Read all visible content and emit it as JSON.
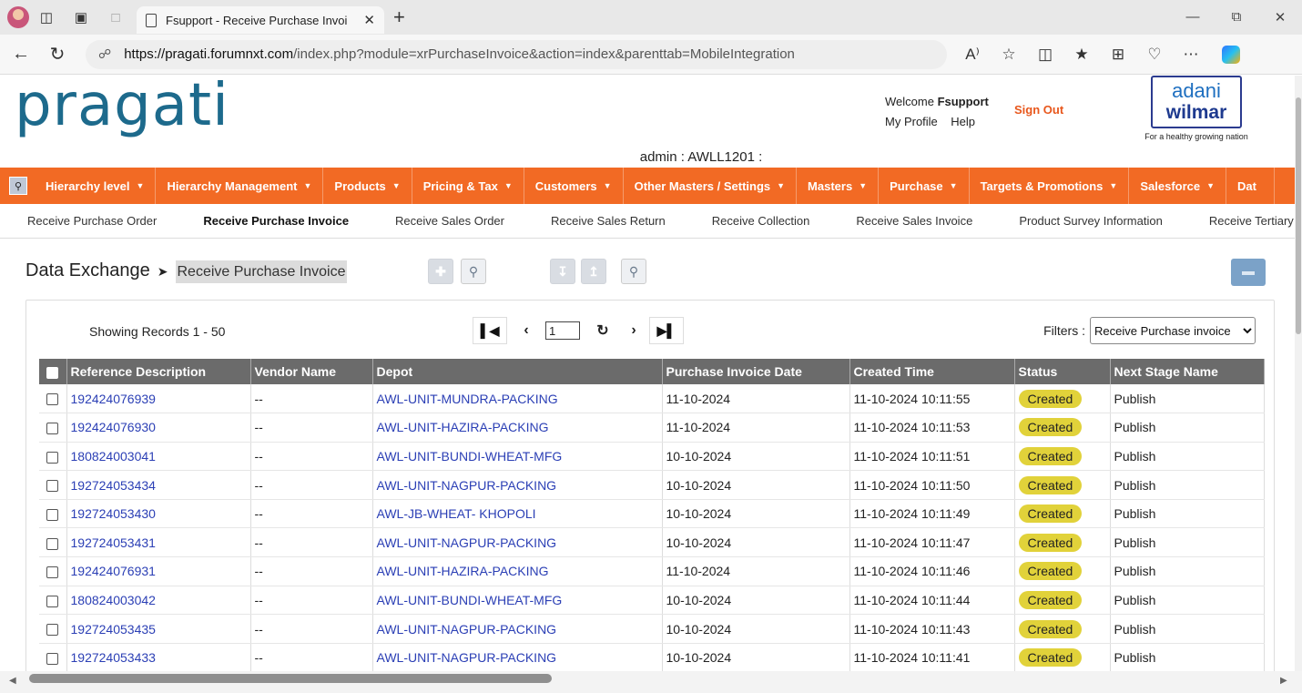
{
  "browser": {
    "tab_title": "Fsupport - Receive Purchase Invoi",
    "url_domain": "https://pragati.forumnxt.com",
    "url_path": "/index.php?module=xrPurchaseInvoice&action=index&parenttab=MobileIntegration"
  },
  "header": {
    "logo": "pragati",
    "welcome_prefix": "Welcome ",
    "welcome_user": "Fsupport",
    "my_profile": "My Profile",
    "help": "Help",
    "sign_out": "Sign Out",
    "brand_line1": "adani",
    "brand_line2": "wilmar",
    "brand_tagline": "For a healthy growing nation",
    "admin_line": "admin : AWLL1201 :"
  },
  "menu": [
    "Hierarchy level",
    "Hierarchy Management",
    "Products",
    "Pricing & Tax",
    "Customers",
    "Other Masters / Settings",
    "Masters",
    "Purchase",
    "Targets & Promotions",
    "Salesforce",
    "Dat"
  ],
  "submenu": [
    "Receive Purchase Order",
    "Receive Purchase Invoice",
    "Receive Sales Order",
    "Receive Sales Return",
    "Receive Collection",
    "Receive Sales Invoice",
    "Product Survey Information",
    "Receive Tertiary Stock"
  ],
  "page": {
    "title": "Data Exchange",
    "current": "Receive Purchase Invoice",
    "records_info": "Showing Records 1 - 50",
    "page_number": "1",
    "filters_label": "Filters :",
    "filter_value": "Receive Purchase invoice"
  },
  "table": {
    "columns": [
      "Reference Description",
      "Vendor Name",
      "Depot",
      "Purchase Invoice Date",
      "Created Time",
      "Status",
      "Next Stage Name"
    ],
    "rows": [
      [
        "192424076939",
        "--",
        "AWL-UNIT-MUNDRA-PACKING",
        "11-10-2024",
        "11-10-2024 10:11:55",
        "Created",
        "Publish"
      ],
      [
        "192424076930",
        "--",
        "AWL-UNIT-HAZIRA-PACKING",
        "11-10-2024",
        "11-10-2024 10:11:53",
        "Created",
        "Publish"
      ],
      [
        "180824003041",
        "--",
        "AWL-UNIT-BUNDI-WHEAT-MFG",
        "10-10-2024",
        "11-10-2024 10:11:51",
        "Created",
        "Publish"
      ],
      [
        "192724053434",
        "--",
        "AWL-UNIT-NAGPUR-PACKING",
        "10-10-2024",
        "11-10-2024 10:11:50",
        "Created",
        "Publish"
      ],
      [
        "192724053430",
        "--",
        "AWL-JB-WHEAT- KHOPOLI",
        "10-10-2024",
        "11-10-2024 10:11:49",
        "Created",
        "Publish"
      ],
      [
        "192724053431",
        "--",
        "AWL-UNIT-NAGPUR-PACKING",
        "10-10-2024",
        "11-10-2024 10:11:47",
        "Created",
        "Publish"
      ],
      [
        "192424076931",
        "--",
        "AWL-UNIT-HAZIRA-PACKING",
        "11-10-2024",
        "11-10-2024 10:11:46",
        "Created",
        "Publish"
      ],
      [
        "180824003042",
        "--",
        "AWL-UNIT-BUNDI-WHEAT-MFG",
        "10-10-2024",
        "11-10-2024 10:11:44",
        "Created",
        "Publish"
      ],
      [
        "192724053435",
        "--",
        "AWL-UNIT-NAGPUR-PACKING",
        "10-10-2024",
        "11-10-2024 10:11:43",
        "Created",
        "Publish"
      ],
      [
        "192724053433",
        "--",
        "AWL-UNIT-NAGPUR-PACKING",
        "10-10-2024",
        "11-10-2024 10:11:41",
        "Created",
        "Publish"
      ]
    ]
  },
  "colors": {
    "menu_bg": "#f26a24",
    "logo": "#1d6a8c",
    "link": "#2b3fb5",
    "badge": "#e1d23a",
    "table_header": "#6b6b6b"
  }
}
